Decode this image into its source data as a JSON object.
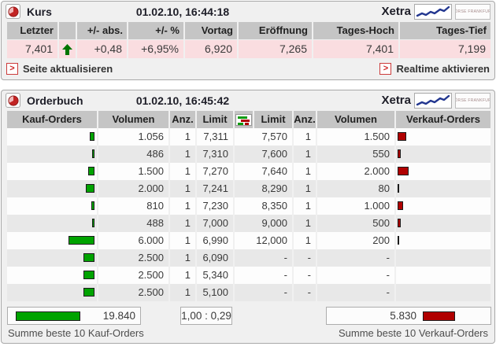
{
  "kurs": {
    "title": "Kurs",
    "datetime": "01.02.10, 16:44:18",
    "exchange": "Xetra",
    "exchange_logo": "BÖRSE FRANKFURT",
    "columns": [
      "Letzter",
      "",
      "+/- abs.",
      "+/- %",
      "Vortag",
      "Eröffnung",
      "Tages-Hoch",
      "Tages-Tief"
    ],
    "values": {
      "letzter": "7,401",
      "trend_icon": "up-arrow",
      "abs_change": "+0,48",
      "pct_change": "+6,95%",
      "vortag": "6,920",
      "eroeffnung": "7,265",
      "tages_hoch": "7,401",
      "tages_tief": "7,199"
    },
    "links": {
      "refresh": "Seite aktualisieren",
      "realtime": "Realtime aktivieren"
    }
  },
  "orderbuch": {
    "title": "Orderbuch",
    "datetime": "01.02.10, 16:45:42",
    "exchange": "Xetra",
    "exchange_logo": "BÖRSE FRANKFURT",
    "columns": [
      "Kauf-Orders",
      "Volumen",
      "Anz.",
      "Limit",
      "Limit",
      "Anz.",
      "Volumen",
      "Verkauf-Orders"
    ],
    "rows": [
      {
        "buy_vol": "1.056",
        "buy_vol_n": 1056,
        "buy_anz": "1",
        "buy_limit": "7,311",
        "sell_limit": "7,570",
        "sell_anz": "1",
        "sell_vol": "1.500",
        "sell_vol_n": 1500
      },
      {
        "buy_vol": "486",
        "buy_vol_n": 486,
        "buy_anz": "1",
        "buy_limit": "7,310",
        "sell_limit": "7,600",
        "sell_anz": "1",
        "sell_vol": "550",
        "sell_vol_n": 550
      },
      {
        "buy_vol": "1.500",
        "buy_vol_n": 1500,
        "buy_anz": "1",
        "buy_limit": "7,270",
        "sell_limit": "7,640",
        "sell_anz": "1",
        "sell_vol": "2.000",
        "sell_vol_n": 2000
      },
      {
        "buy_vol": "2.000",
        "buy_vol_n": 2000,
        "buy_anz": "1",
        "buy_limit": "7,241",
        "sell_limit": "8,290",
        "sell_anz": "1",
        "sell_vol": "80",
        "sell_vol_n": 80
      },
      {
        "buy_vol": "810",
        "buy_vol_n": 810,
        "buy_anz": "1",
        "buy_limit": "7,230",
        "sell_limit": "8,350",
        "sell_anz": "1",
        "sell_vol": "1.000",
        "sell_vol_n": 1000
      },
      {
        "buy_vol": "488",
        "buy_vol_n": 488,
        "buy_anz": "1",
        "buy_limit": "7,000",
        "sell_limit": "9,000",
        "sell_anz": "1",
        "sell_vol": "500",
        "sell_vol_n": 500
      },
      {
        "buy_vol": "6.000",
        "buy_vol_n": 6000,
        "buy_anz": "1",
        "buy_limit": "6,990",
        "sell_limit": "12,000",
        "sell_anz": "1",
        "sell_vol": "200",
        "sell_vol_n": 200
      },
      {
        "buy_vol": "2.500",
        "buy_vol_n": 2500,
        "buy_anz": "1",
        "buy_limit": "6,090",
        "sell_limit": "-",
        "sell_anz": "-",
        "sell_vol": "-",
        "sell_vol_n": null
      },
      {
        "buy_vol": "2.500",
        "buy_vol_n": 2500,
        "buy_anz": "1",
        "buy_limit": "5,340",
        "sell_limit": "-",
        "sell_anz": "-",
        "sell_vol": "-",
        "sell_vol_n": null
      },
      {
        "buy_vol": "2.500",
        "buy_vol_n": 2500,
        "buy_anz": "1",
        "buy_limit": "5,100",
        "sell_limit": "-",
        "sell_anz": "-",
        "sell_vol": "-",
        "sell_vol_n": null
      }
    ],
    "summary": {
      "buy_total": "19.840",
      "buy_total_n": 19840,
      "ratio": "1,00 : 0,29",
      "sell_total": "5.830",
      "sell_total_n": 5830
    },
    "footer": {
      "left": "Summe beste 10 Kauf-Orders",
      "right": "Summe beste 10 Verkauf-Orders"
    }
  },
  "colors": {
    "positive_green": "#008000",
    "buy_bar": "#00a300",
    "sell_bar": "#b00000",
    "quote_row_pink": "#fadde0",
    "header_gray": "#c5c5c5",
    "panel_bg": "#f0f0f0"
  }
}
